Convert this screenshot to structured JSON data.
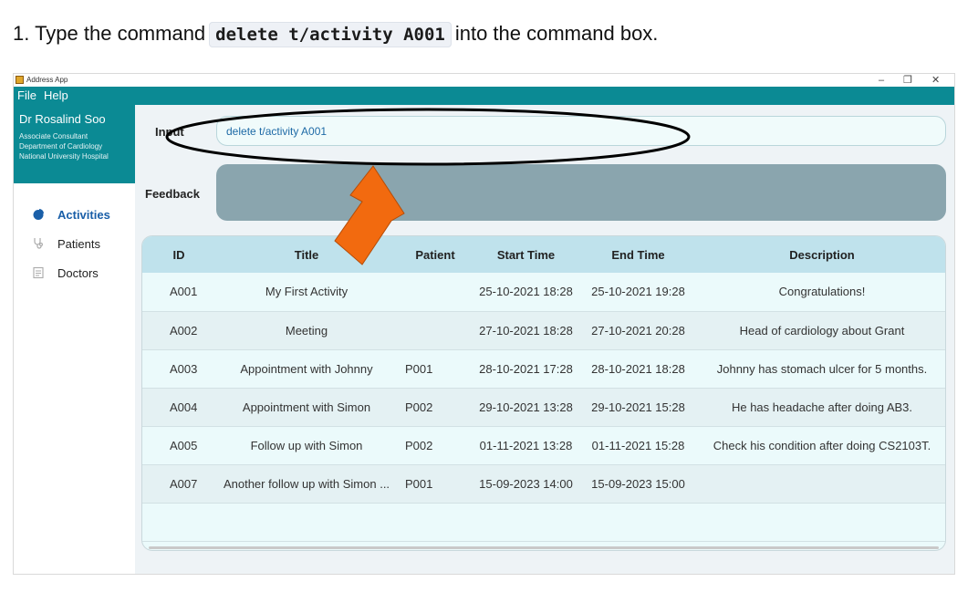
{
  "instruction": {
    "prefix": "1. Type the command",
    "command": "delete t/activity A001",
    "suffix": "into the command box."
  },
  "window": {
    "title": "Address App",
    "minimize": "–",
    "maximize": "❐",
    "close": "✕"
  },
  "menu": {
    "file": "File",
    "help": "Help"
  },
  "profile": {
    "name": "Dr Rosalind Soo",
    "line1": "Associate Consultant",
    "line2": "Department of Cardiology",
    "line3": "National University Hospital"
  },
  "nav": [
    {
      "label": "Activities",
      "icon": "pie-chart-icon",
      "active": true
    },
    {
      "label": "Patients",
      "icon": "stethoscope-icon",
      "active": false
    },
    {
      "label": "Doctors",
      "icon": "clipboard-icon",
      "active": false
    }
  ],
  "command": {
    "label": "Input",
    "value": "delete t/activity A001"
  },
  "feedback": {
    "label": "Feedback",
    "text": ""
  },
  "table": {
    "columns": [
      "ID",
      "Title",
      "Patient",
      "Start Time",
      "End Time",
      "Description"
    ],
    "rows": [
      [
        "A001",
        "My First Activity",
        "",
        "25-10-2021 18:28",
        "25-10-2021 19:28",
        "Congratulations!"
      ],
      [
        "A002",
        "Meeting",
        "",
        "27-10-2021 18:28",
        "27-10-2021 20:28",
        "Head of cardiology about Grant"
      ],
      [
        "A003",
        "Appointment with Johnny",
        "P001",
        "28-10-2021 17:28",
        "28-10-2021 18:28",
        "Johnny has stomach ulcer for 5 months."
      ],
      [
        "A004",
        "Appointment with Simon",
        "P002",
        "29-10-2021 13:28",
        "29-10-2021 15:28",
        "He has headache after doing AB3."
      ],
      [
        "A005",
        "Follow up with Simon",
        "P002",
        "01-11-2021 13:28",
        "01-11-2021 15:28",
        "Check his condition after doing CS2103T."
      ],
      [
        "A007",
        "Another follow up with Simon ...",
        "P001",
        "15-09-2023 14:00",
        "15-09-2023 15:00",
        ""
      ]
    ]
  },
  "colors": {
    "accent": "#0b8a94",
    "arrow": "#f26a0f",
    "header": "#bfe2ec",
    "feedback": "#8aa5ae"
  }
}
